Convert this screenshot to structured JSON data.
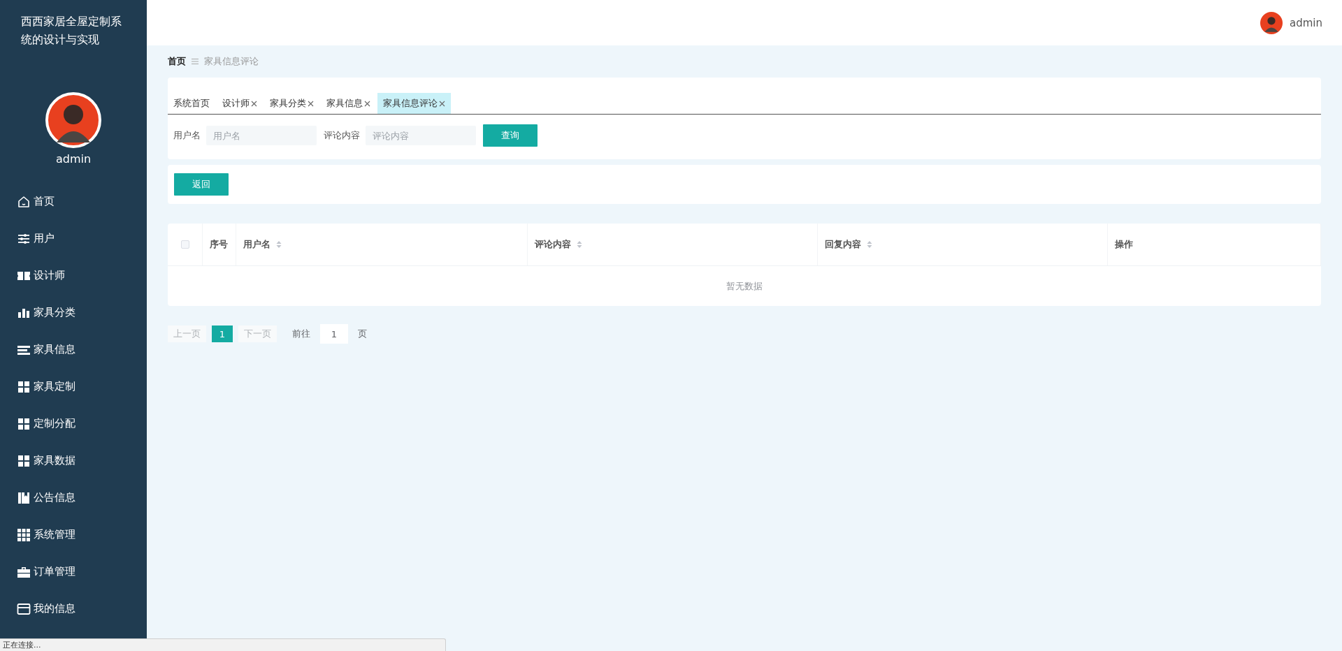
{
  "sidebar": {
    "title": "西西家居全屋定制系统的设计与实现",
    "user_name": "admin",
    "menu": [
      {
        "label": "首页"
      },
      {
        "label": "用户"
      },
      {
        "label": "设计师"
      },
      {
        "label": "家具分类"
      },
      {
        "label": "家具信息"
      },
      {
        "label": "家具定制"
      },
      {
        "label": "定制分配"
      },
      {
        "label": "家具数据"
      },
      {
        "label": "公告信息"
      },
      {
        "label": "系统管理"
      },
      {
        "label": "订单管理"
      },
      {
        "label": "我的信息"
      }
    ]
  },
  "header": {
    "user_name": "admin"
  },
  "breadcrumb": {
    "items": [
      "首页",
      "家具信息评论"
    ]
  },
  "tabs": [
    {
      "label": "系统首页",
      "closable": false,
      "selected": false
    },
    {
      "label": "设计师",
      "closable": true,
      "selected": false
    },
    {
      "label": "家具分类",
      "closable": true,
      "selected": false
    },
    {
      "label": "家具信息",
      "closable": true,
      "selected": false
    },
    {
      "label": "家具信息评论",
      "closable": true,
      "selected": true
    }
  ],
  "search": {
    "fields": [
      {
        "label": "用户名",
        "placeholder": "用户名"
      },
      {
        "label": "评论内容",
        "placeholder": "评论内容"
      }
    ],
    "button": "查询"
  },
  "actions": {
    "button": "返回"
  },
  "table": {
    "select_all_checked": false,
    "columns": [
      {
        "label": "序号",
        "sortable": false
      },
      {
        "label": "用户名",
        "sortable": true
      },
      {
        "label": "评论内容",
        "sortable": true
      },
      {
        "label": "回复内容",
        "sortable": true
      },
      {
        "label": "操作",
        "sortable": false
      }
    ],
    "empty_text": "暂无数据"
  },
  "pagination": {
    "prev": "上一页",
    "pages": [
      {
        "label": "1",
        "selected": true
      }
    ],
    "next": "下一页",
    "goto_label": "前往",
    "goto_value": "1",
    "page_suffix": "页"
  },
  "status_bubble": "正在连接..."
}
